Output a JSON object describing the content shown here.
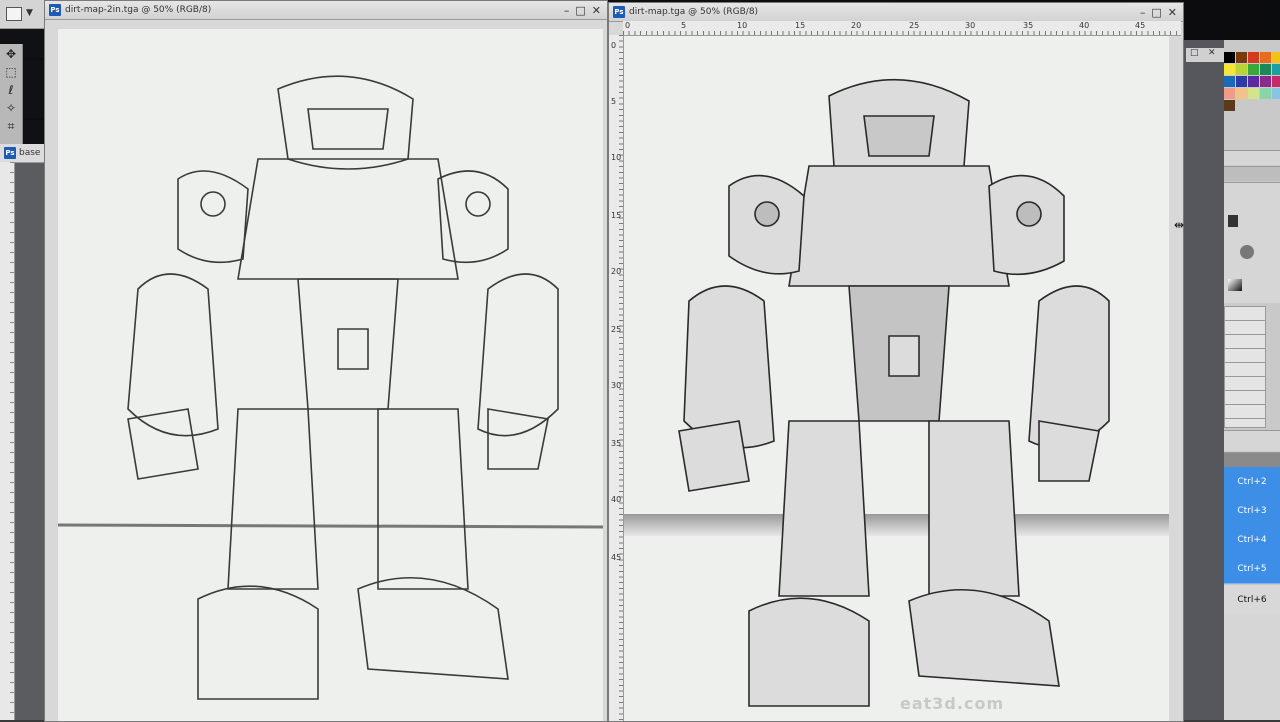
{
  "windows": {
    "left": {
      "title": "dirt-map-2in.tga @ 50% (RGB/8)"
    },
    "right": {
      "title": "dirt-map.tga @ 50% (RGB/8)"
    },
    "base": {
      "title": "base"
    }
  },
  "controls": {
    "minimize": "–",
    "maximize": "□",
    "close": "✕"
  },
  "ruler": {
    "horizontal": [
      "0",
      "5",
      "10",
      "15",
      "20",
      "25",
      "30",
      "35",
      "40",
      "45"
    ],
    "vertical": [
      "0",
      "5",
      "10",
      "15",
      "20",
      "25",
      "30",
      "35",
      "40",
      "45"
    ]
  },
  "actions": [
    {
      "label": "Ctrl+2",
      "selected": true
    },
    {
      "label": "Ctrl+3",
      "selected": true
    },
    {
      "label": "Ctrl+4",
      "selected": true
    },
    {
      "label": "Ctrl+5",
      "selected": true
    },
    {
      "label": "Ctrl+6",
      "selected": false
    }
  ],
  "watermark": "eat3d.com",
  "swatch_colors": [
    "#000000",
    "#7a3a10",
    "#d23b1e",
    "#e86a1a",
    "#f2c21a",
    "#f7e43a",
    "#b8d43a",
    "#3aa83a",
    "#1a8a5a",
    "#1aa0a0",
    "#1a6ab8",
    "#2a3aa8",
    "#5a2aa0",
    "#8a2a8a",
    "#c42a6a",
    "#f29a8a",
    "#f2c28a",
    "#d4e48a",
    "#8ad4aa",
    "#8ac4e4",
    "#5a3a1a"
  ]
}
